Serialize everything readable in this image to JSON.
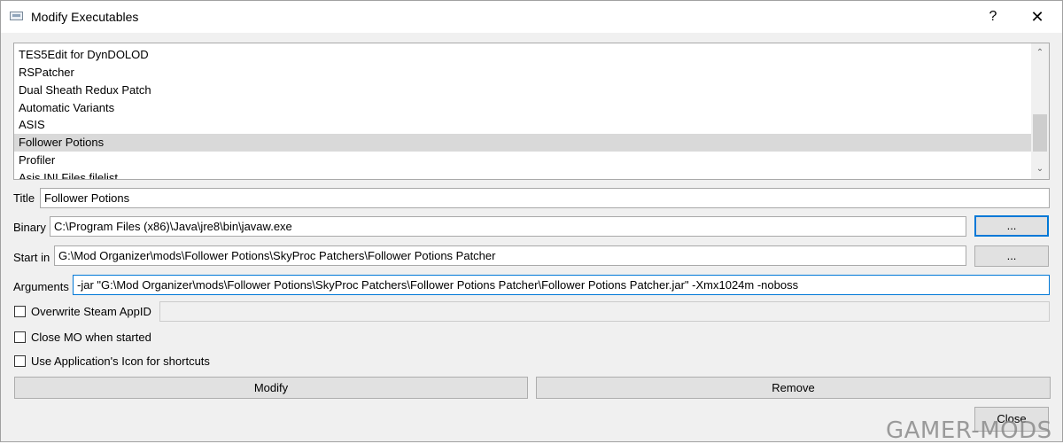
{
  "window": {
    "title": "Modify Executables",
    "help_label": "?",
    "close_label": "✕"
  },
  "executables": {
    "items": [
      {
        "label": "TES5Edit for DynDOLOD",
        "selected": false
      },
      {
        "label": "RSPatcher",
        "selected": false
      },
      {
        "label": "Dual Sheath Redux Patch",
        "selected": false
      },
      {
        "label": "Automatic Variants",
        "selected": false
      },
      {
        "label": "ASIS",
        "selected": false
      },
      {
        "label": "Follower Potions",
        "selected": true
      },
      {
        "label": "Profiler",
        "selected": false
      },
      {
        "label": "Asis INI Files filelist",
        "selected": false
      }
    ],
    "scroll_up": "⌃",
    "scroll_down": "⌄"
  },
  "form": {
    "title_label": "Title",
    "title_value": "Follower Potions",
    "binary_label": "Binary",
    "binary_value": "C:\\Program Files (x86)\\Java\\jre8\\bin\\javaw.exe",
    "binary_browse": "...",
    "startin_label": "Start in",
    "startin_value": "G:\\Mod Organizer\\mods\\Follower Potions\\SkyProc Patchers\\Follower Potions Patcher",
    "startin_browse": "...",
    "arguments_label": "Arguments",
    "arguments_value": "-jar \"G:\\Mod Organizer\\mods\\Follower Potions\\SkyProc Patchers\\Follower Potions Patcher\\Follower Potions Patcher.jar\" -Xmx1024m -noboss",
    "steam_appid_label": "Overwrite Steam AppID",
    "steam_appid_value": "",
    "close_mo_label": "Close MO when started",
    "use_icon_label": "Use Application's Icon for shortcuts"
  },
  "checkboxes": {
    "steam_appid": false,
    "close_mo": false,
    "use_icon": false
  },
  "buttons": {
    "modify": "Modify",
    "remove": "Remove",
    "close": "Close"
  },
  "watermark": "GAMER-MODS",
  "colors": {
    "accent": "#0078d7",
    "selection": "#d9d9d9"
  }
}
